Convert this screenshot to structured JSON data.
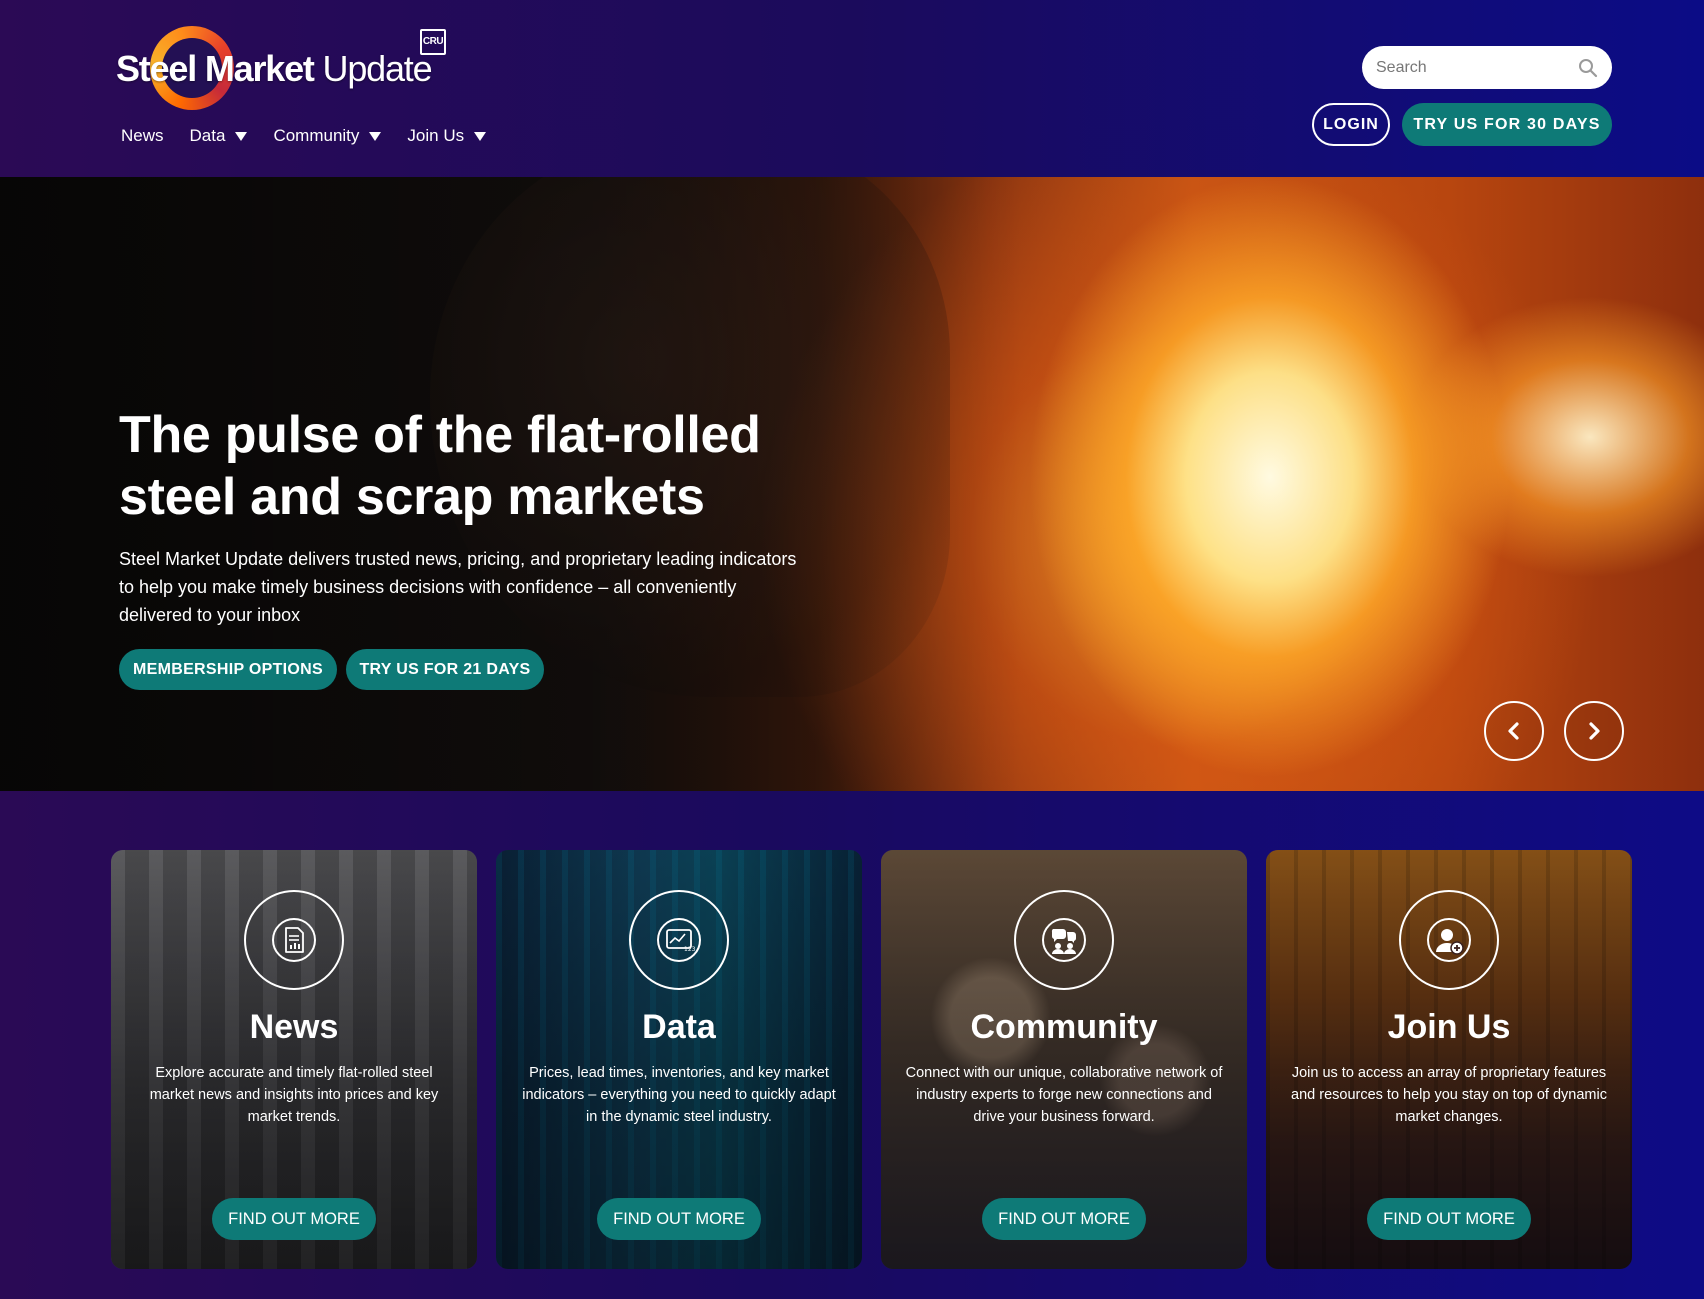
{
  "header": {
    "logo": {
      "bold": "Steel Market",
      "light": "Update",
      "badge": "CRU"
    },
    "nav": [
      {
        "label": "News",
        "has_dropdown": false
      },
      {
        "label": "Data",
        "has_dropdown": true
      },
      {
        "label": "Community",
        "has_dropdown": true
      },
      {
        "label": "Join Us",
        "has_dropdown": true
      }
    ],
    "search": {
      "placeholder": "Search",
      "value": ""
    },
    "login_label": "LOGIN",
    "trial_label": "TRY US FOR 30 DAYS"
  },
  "hero": {
    "title": "The pulse of the flat-rolled steel and scrap markets",
    "description": "Steel Market Update delivers trusted news, pricing, and proprietary leading indicators to help you make timely business decisions with confidence – all conveniently delivered to your inbox",
    "membership_label": "MEMBERSHIP OPTIONS",
    "trial_label": "TRY US FOR 21 DAYS"
  },
  "cards": [
    {
      "title": "News",
      "icon": "news-document-icon",
      "description": "Explore accurate and timely flat-rolled steel market news and insights into prices and key market trends.",
      "button": "FIND OUT MORE"
    },
    {
      "title": "Data",
      "icon": "data-chart-icon",
      "description": "Prices, lead times, inventories, and key market indicators – everything you need to quickly adapt in the dynamic steel industry.",
      "button": "FIND OUT MORE"
    },
    {
      "title": "Community",
      "icon": "community-people-icon",
      "description": "Connect with our unique, collaborative network of industry experts to forge new connections and drive your business forward.",
      "button": "FIND OUT MORE"
    },
    {
      "title": "Join Us",
      "icon": "join-user-add-icon",
      "description": "Join us to access an array of proprietary features and resources to help you stay on top of dynamic market changes.",
      "button": "FIND OUT MORE"
    }
  ],
  "colors": {
    "accent_teal": "#0e7a77",
    "header_left": "#2b0a55",
    "header_right": "#0b0c86"
  }
}
